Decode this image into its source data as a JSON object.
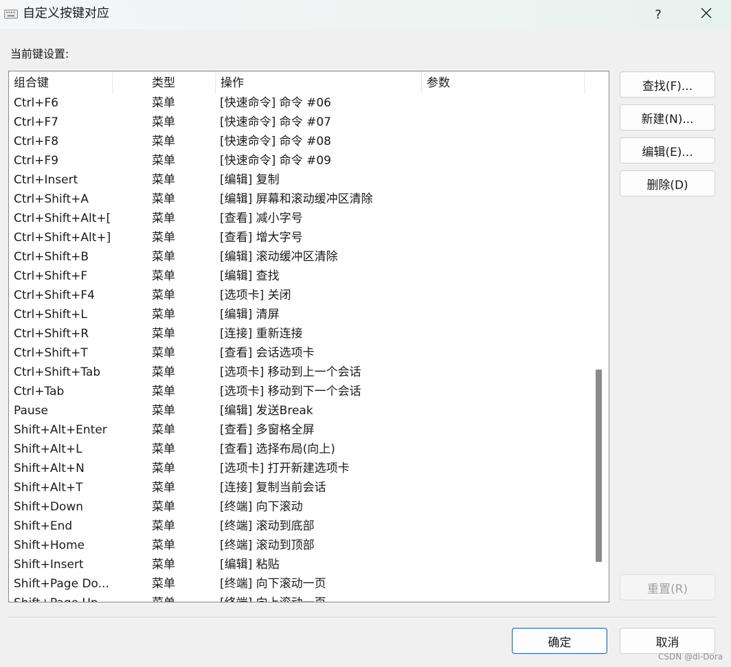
{
  "window": {
    "title": "自定义按键对应",
    "help_label": "?"
  },
  "section_label": "当前键设置:",
  "columns": [
    "组合键",
    "类型",
    "操作",
    "参数"
  ],
  "rows": [
    [
      "Ctrl+F6",
      "菜单",
      "[快速命令] 命令 #06",
      ""
    ],
    [
      "Ctrl+F7",
      "菜单",
      "[快速命令] 命令 #07",
      ""
    ],
    [
      "Ctrl+F8",
      "菜单",
      "[快速命令] 命令 #08",
      ""
    ],
    [
      "Ctrl+F9",
      "菜单",
      "[快速命令] 命令 #09",
      ""
    ],
    [
      "Ctrl+Insert",
      "菜单",
      "[编辑] 复制",
      ""
    ],
    [
      "Ctrl+Shift+A",
      "菜单",
      "[编辑] 屏幕和滚动缓冲区清除",
      ""
    ],
    [
      "Ctrl+Shift+Alt+[",
      "菜单",
      "[查看] 减小字号",
      ""
    ],
    [
      "Ctrl+Shift+Alt+]",
      "菜单",
      "[查看] 增大字号",
      ""
    ],
    [
      "Ctrl+Shift+B",
      "菜单",
      "[编辑] 滚动缓冲区清除",
      ""
    ],
    [
      "Ctrl+Shift+F",
      "菜单",
      "[编辑] 查找",
      ""
    ],
    [
      "Ctrl+Shift+F4",
      "菜单",
      "[选项卡] 关闭",
      ""
    ],
    [
      "Ctrl+Shift+L",
      "菜单",
      "[编辑] 清屏",
      ""
    ],
    [
      "Ctrl+Shift+R",
      "菜单",
      "[连接] 重新连接",
      ""
    ],
    [
      "Ctrl+Shift+T",
      "菜单",
      "[查看] 会话选项卡",
      ""
    ],
    [
      "Ctrl+Shift+Tab",
      "菜单",
      "[选项卡] 移动到上一个会话",
      ""
    ],
    [
      "Ctrl+Tab",
      "菜单",
      "[选项卡] 移动到下一个会话",
      ""
    ],
    [
      "Pause",
      "菜单",
      "[编辑] 发送Break",
      ""
    ],
    [
      "Shift+Alt+Enter",
      "菜单",
      "[查看] 多窗格全屏",
      ""
    ],
    [
      "Shift+Alt+L",
      "菜单",
      "[查看] 选择布局(向上)",
      ""
    ],
    [
      "Shift+Alt+N",
      "菜单",
      "[选项卡] 打开新建选项卡",
      ""
    ],
    [
      "Shift+Alt+T",
      "菜单",
      "[连接] 复制当前会话",
      ""
    ],
    [
      "Shift+Down",
      "菜单",
      "[终端] 向下滚动",
      ""
    ],
    [
      "Shift+End",
      "菜单",
      "[终端] 滚动到底部",
      ""
    ],
    [
      "Shift+Home",
      "菜单",
      "[终端] 滚动到顶部",
      ""
    ],
    [
      "Shift+Insert",
      "菜单",
      "[编辑] 粘贴",
      ""
    ],
    [
      "Shift+Page Do...",
      "菜单",
      "[终端] 向下滚动一页",
      ""
    ],
    [
      "Shift+Page Up",
      "菜单",
      "[终端] 向上滚动一页",
      ""
    ]
  ],
  "buttons": {
    "find": "查找(F)...",
    "new": "新建(N)...",
    "edit": "编辑(E)...",
    "delete": "删除(D)",
    "reset": "重置(R)",
    "ok": "确定",
    "cancel": "取消"
  },
  "watermark": "CSDN @di-Dora",
  "icons": {
    "app": "keyboard-icon",
    "close": "close-icon"
  }
}
